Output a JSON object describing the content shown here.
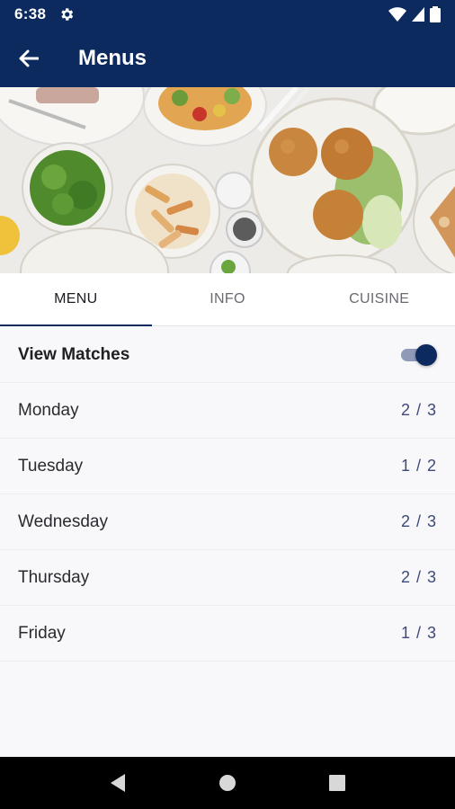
{
  "status_bar": {
    "time": "6:38",
    "icons": [
      "settings-gear-icon",
      "wifi-icon",
      "signal-icon",
      "battery-icon"
    ]
  },
  "app_bar": {
    "title": "Menus",
    "back_icon": "arrow-left-icon"
  },
  "hero": {
    "image": "food-platters-photo"
  },
  "tabs": [
    {
      "label": "MENU",
      "active": true
    },
    {
      "label": "INFO",
      "active": false
    },
    {
      "label": "CUISINE",
      "active": false
    }
  ],
  "view_matches": {
    "label": "View Matches",
    "enabled": true
  },
  "days": [
    {
      "label": "Monday",
      "count": "2 / 3"
    },
    {
      "label": "Tuesday",
      "count": "1 / 2"
    },
    {
      "label": "Wednesday",
      "count": "2 / 3"
    },
    {
      "label": "Thursday",
      "count": "2 / 3"
    },
    {
      "label": "Friday",
      "count": "1 / 3"
    }
  ],
  "nav_bar": {
    "icons": [
      "back-triangle-icon",
      "home-circle-icon",
      "recents-square-icon"
    ]
  },
  "colors": {
    "primary": "#0c2a5e",
    "count_text": "#3d4a7a",
    "background": "#f8f8fa"
  }
}
